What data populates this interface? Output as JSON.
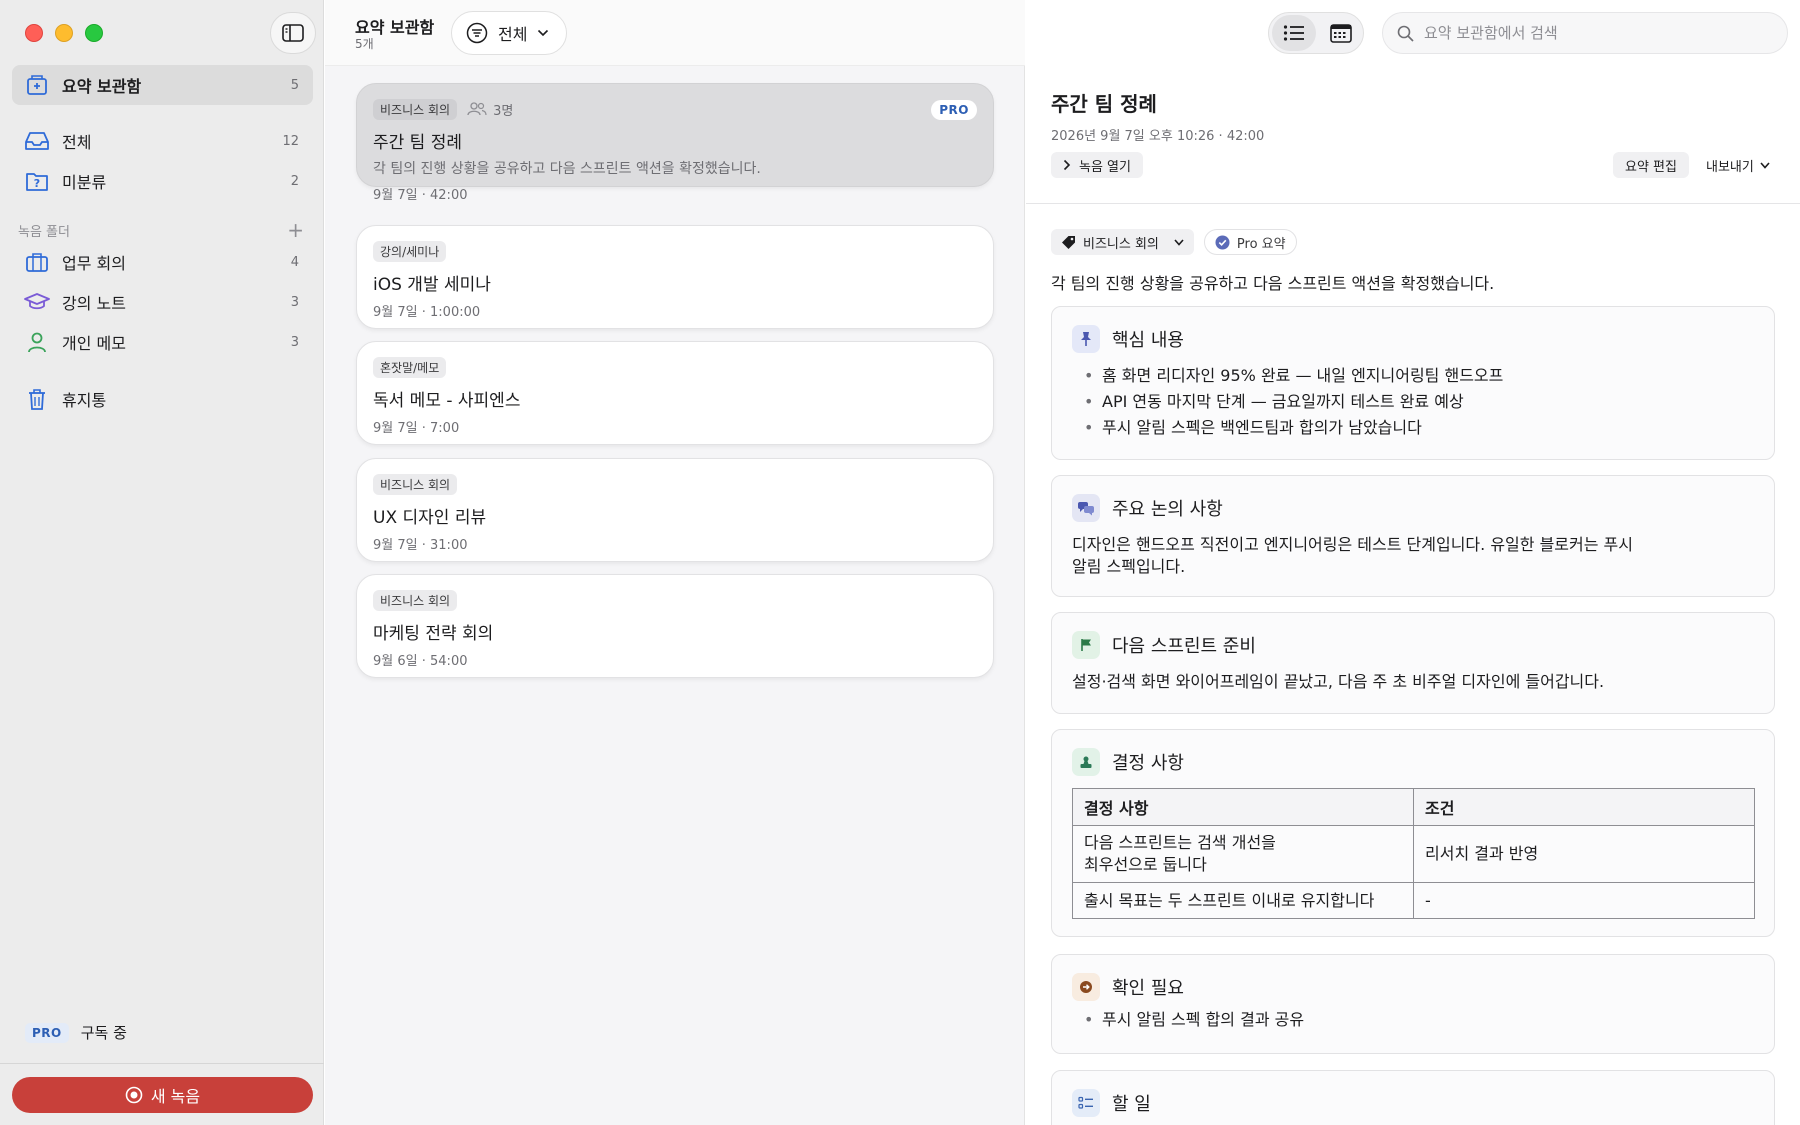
{
  "sidebar": {
    "nav": [
      {
        "label": "요약 보관함",
        "count": "5"
      },
      {
        "label": "전체",
        "count": "12"
      },
      {
        "label": "미분류",
        "count": "2"
      }
    ],
    "folders_title": "녹음 폴더",
    "folders": [
      {
        "label": "업무 회의",
        "count": "4"
      },
      {
        "label": "강의 노트",
        "count": "3"
      },
      {
        "label": "개인 메모",
        "count": "3"
      }
    ],
    "trash": "휴지통",
    "pro_badge": "PRO",
    "pro_status": "구독 중",
    "new_recording": "새 녹음"
  },
  "list": {
    "title": "요약 보관함",
    "subtitle": "5개",
    "filter": "전체",
    "cards": [
      {
        "tag": "비즈니스 회의",
        "people": "3명",
        "pro": "PRO",
        "title": "주간 팀 정례",
        "desc": "각 팀의 진행 상황을 공유하고 다음 스프린트 액션을 확정했습니다.",
        "date": "9월 7일",
        "duration": "42:00"
      },
      {
        "tag": "강의/세미나",
        "title": "iOS 개발 세미나",
        "date": "9월 7일",
        "duration": "1:00:00"
      },
      {
        "tag": "혼잣말/메모",
        "title": "독서 메모 - 사피엔스",
        "date": "9월 7일",
        "duration": "7:00"
      },
      {
        "tag": "비즈니스 회의",
        "title": "UX 디자인 리뷰",
        "date": "9월 7일",
        "duration": "31:00"
      },
      {
        "tag": "비즈니스 회의",
        "title": "마케팅 전략 회의",
        "date": "9월 6일",
        "duration": "54:00"
      }
    ]
  },
  "detail": {
    "search_placeholder": "요약 보관함에서 검색",
    "title": "주간 팀 정례",
    "datetime": "2026년 9월 7일 오후 10:26",
    "duration": "42:00",
    "open_recording": "녹음 열기",
    "edit_summary": "요약 편집",
    "export": "내보내기",
    "category": "비즈니스 회의",
    "pro_summary": "Pro 요약",
    "summary": "각 팀의 진행 상황을 공유하고 다음 스프린트 액션을 확정했습니다.",
    "key_points": {
      "title": "핵심 내용",
      "items": [
        "홈 화면 리디자인 95% 완료 — 내일 엔지니어링팀 핸드오프",
        "API 연동 마지막 단계 — 금요일까지 테스트 완료 예상",
        "푸시 알림 스펙은 백엔드팀과 합의가 남았습니다"
      ]
    },
    "discussion": {
      "title": "주요 논의 사항",
      "line1": "디자인은 핸드오프 직전이고 엔지니어링은 테스트 단계입니다. 유일한 블로커는 푸시",
      "line2": "알림 스펙입니다."
    },
    "next_sprint": {
      "title": "다음 스프린트 준비",
      "text": "설정·검색 화면 와이어프레임이 끝났고, 다음 주 초 비주얼 디자인에 들어갑니다."
    },
    "decisions": {
      "title": "결정 사항",
      "col1": "결정 사항",
      "col2": "조건",
      "rows": [
        {
          "d1": "다음 스프린트는 검색 개선을",
          "d2": "최우선으로 둡니다",
          "cond": "리서치 결과 반영"
        },
        {
          "d1": "출시 목표는 두 스프린트 이내로 유지합니다",
          "cond": "-"
        }
      ]
    },
    "check": {
      "title": "확인 필요",
      "items": [
        "푸시 알림 스펙 합의 결과 공유"
      ]
    },
    "todo": {
      "title": "할 일"
    }
  },
  "colors": {
    "accent_red": "#c8403a",
    "pro_blue": "#2d5fb4",
    "folder_blue": "#2f6bd8",
    "lecture_purple": "#7a5bd6",
    "memo_green": "#3aa35a"
  }
}
